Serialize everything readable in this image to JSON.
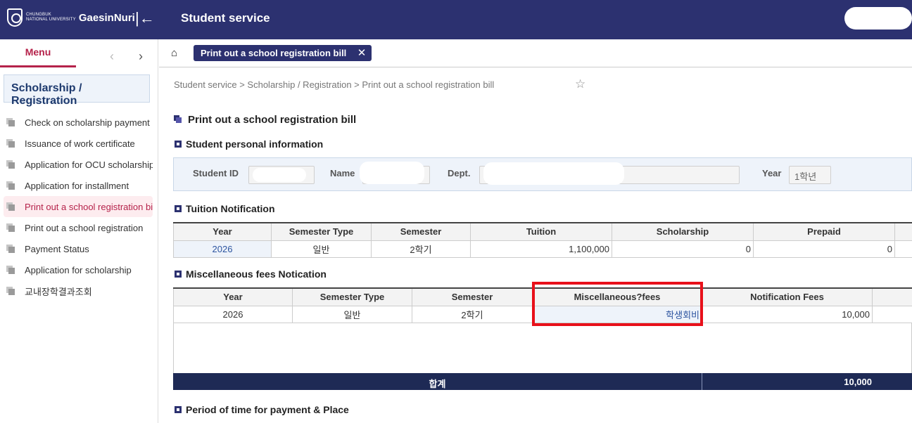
{
  "header": {
    "logo_univ_line1": "CHUNGBUK",
    "logo_univ_line2": "NATIONAL UNIVERSITY",
    "logo_name": "GaesinNuri",
    "app_title": "Student service"
  },
  "sidebar": {
    "menu_tab": "Menu",
    "group_title": "Scholarship / Registration",
    "items": [
      {
        "label": "Check on scholarship payment"
      },
      {
        "label": "Issuance of work certificate"
      },
      {
        "label": "Application for OCU scholarship"
      },
      {
        "label": "Application for installment"
      },
      {
        "label": "Print out a school registration bill"
      },
      {
        "label": "Print out a school registration"
      },
      {
        "label": "Payment Status"
      },
      {
        "label": "Application for scholarship"
      },
      {
        "label": "교내장학결과조회"
      }
    ],
    "active_index": 4
  },
  "tabs": [
    {
      "label": "Print out a school registration bill"
    }
  ],
  "breadcrumb": "Student service > Scholarship / Registration > Print out a school registration bill",
  "page_title": "Print out a school registration bill",
  "personal": {
    "section_title": "Student personal information",
    "student_id_label": "Student ID",
    "student_id": "",
    "name_label": "Name",
    "name": "",
    "dept_label": "Dept.",
    "dept": "",
    "year_label": "Year",
    "year": "1학년"
  },
  "tuition": {
    "section_title": "Tuition Notification",
    "headers": [
      "Year",
      "Semester Type",
      "Semester",
      "Tuition",
      "Scholarship",
      "Prepaid"
    ],
    "row": [
      "2026",
      "일반",
      "2학기",
      "1,100,000",
      "0",
      "0"
    ]
  },
  "misc": {
    "section_title": "Miscellaneous fees Notication",
    "headers": [
      "Year",
      "Semester Type",
      "Semester",
      "Miscellaneous?fees",
      "Notification Fees"
    ],
    "row": [
      "2026",
      "일반",
      "2학기",
      "학생회비",
      "10,000"
    ],
    "total_label": "합계",
    "total_value": "10,000"
  },
  "payment": {
    "section_title": "Period of time for payment & Place"
  },
  "colors": {
    "navy": "#2c3170",
    "accent": "#b5224a",
    "highlight": "#e8101a"
  }
}
